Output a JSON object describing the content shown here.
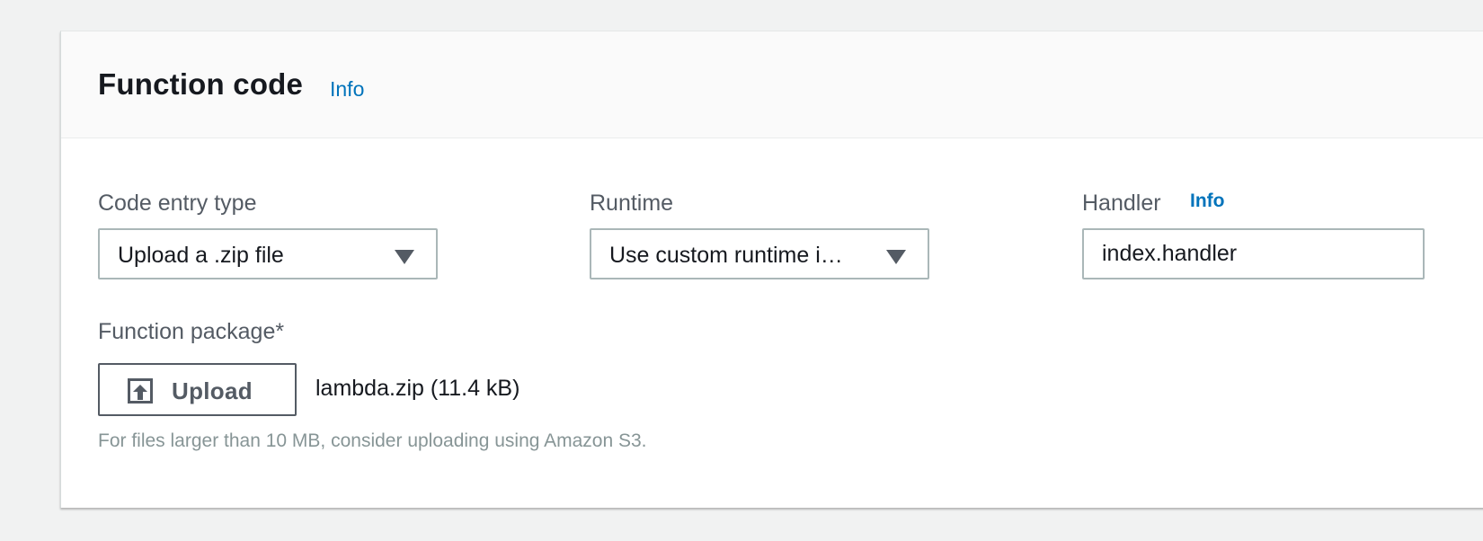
{
  "section": {
    "title": "Function code",
    "info_link": "Info"
  },
  "code_entry": {
    "label": "Code entry type",
    "selected": "Upload a .zip file"
  },
  "runtime": {
    "label": "Runtime",
    "selected": "Use custom runtime i…"
  },
  "handler": {
    "label": "Handler",
    "info_link": "Info",
    "value": "index.handler"
  },
  "package": {
    "label": "Function package*",
    "upload_label": "Upload",
    "file_name": "lambda.zip (11.4 kB)",
    "hint": "For files larger than 10 MB, consider uploading using Amazon S3."
  },
  "icons": {
    "upload": "upload-icon",
    "dropdown": "caret-down-icon"
  },
  "colors": {
    "link": "#0073bb",
    "text": "#16191f",
    "label": "#545b64",
    "hint": "#879596",
    "border": "#aab7b8",
    "background": "#f1f2f2"
  }
}
